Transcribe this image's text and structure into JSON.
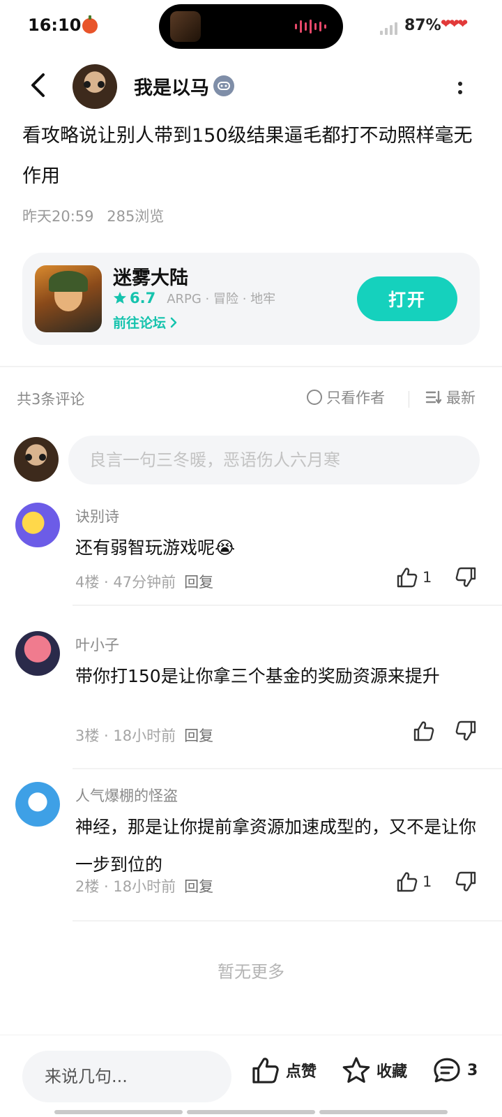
{
  "status_bar": {
    "time": "16:10",
    "battery": "87%",
    "hearts": "❤❤❤"
  },
  "header": {
    "author_name": "我是以马"
  },
  "post": {
    "text": "看攻略说让别人带到150级结果逼毛都打不动照样毫无作用",
    "time": "昨天20:59",
    "views": "285浏览"
  },
  "game_card": {
    "title": "迷雾大陆",
    "rating": "6.7",
    "tags": "ARPG · 冒险 · 地牢",
    "forum_link": "前往论坛",
    "open_label": "打开",
    "accent_color": "#15c3ad"
  },
  "comments_header": {
    "count_label": "共3条评论",
    "only_author": "只看作者",
    "sort_label": "最新"
  },
  "comment_input": {
    "placeholder": "良言一句三冬暖，恶语伤人六月寒"
  },
  "comments": [
    {
      "user": "诀别诗",
      "text": "还有弱智玩游戏呢😭",
      "floor": "4楼",
      "time": "47分钟前",
      "reply": "回复",
      "likes": "1"
    },
    {
      "user": "叶小子",
      "text": "带你打150是让你拿三个基金的奖励资源来提升",
      "floor": "3楼",
      "time": "18小时前",
      "reply": "回复",
      "likes": ""
    },
    {
      "user": "人气爆棚的怪盗",
      "text": "神经，那是让你提前拿资源加速成型的，又不是让你一步到位的",
      "floor": "2楼",
      "time": "18小时前",
      "reply": "回复",
      "likes": "1"
    }
  ],
  "no_more": "暂无更多",
  "bottom_bar": {
    "input_placeholder": "来说几句...",
    "like_label": "点赞",
    "fav_label": "收藏",
    "comment_count": "3"
  }
}
